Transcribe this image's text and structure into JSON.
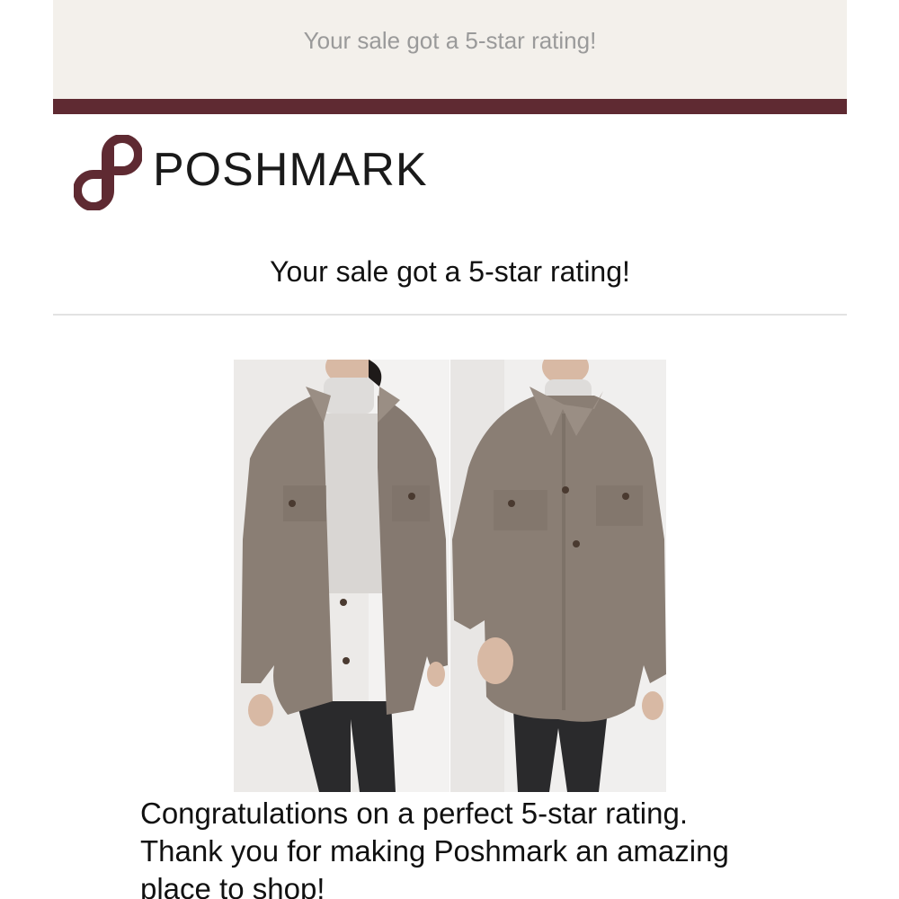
{
  "email": {
    "preheader": "Your sale got a 5-star rating!",
    "brand": {
      "wordmark": "POSHMARK",
      "logo_icon": "poshmark-logo-icon",
      "bar_color": "#5f2a32",
      "mark_color": "#5f2a32"
    },
    "headline": "Your sale got a 5-star rating!",
    "product_images": [
      {
        "name": "jacket-photo-open",
        "description_icon": "product-photo"
      },
      {
        "name": "jacket-photo-buttoned",
        "description_icon": "product-photo"
      }
    ],
    "body": {
      "line1": "Congratulations on a perfect 5-star rating.",
      "line2": "Thank you for making Poshmark an amazing",
      "line3": "place to shop!"
    }
  }
}
